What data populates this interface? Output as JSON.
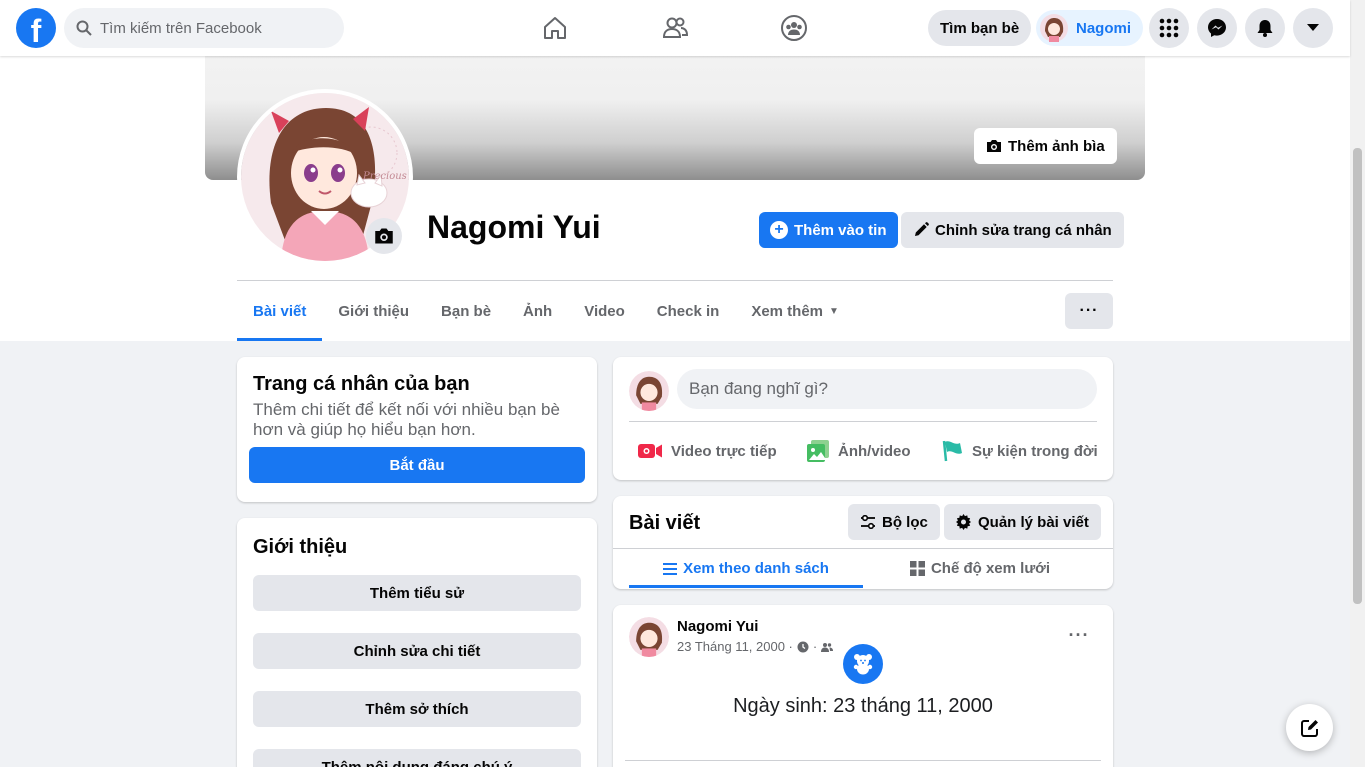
{
  "topbar": {
    "search_placeholder": "Tìm kiếm trên Facebook",
    "find_friends": "Tìm bạn bè",
    "profile_name": "Nagomi",
    "logo_letter": "f"
  },
  "cover": {
    "add_cover_label": "Thêm ảnh bìa"
  },
  "profile": {
    "name": "Nagomi Yui",
    "add_story_label": "Thêm vào tin",
    "edit_profile_label": "Chỉnh sửa trang cá nhân"
  },
  "tabs": [
    {
      "label": "Bài viết"
    },
    {
      "label": "Giới thiệu"
    },
    {
      "label": "Bạn bè"
    },
    {
      "label": "Ảnh"
    },
    {
      "label": "Video"
    },
    {
      "label": "Check in"
    },
    {
      "label": "Xem thêm"
    }
  ],
  "more_label": "···",
  "profile_card": {
    "title": "Trang cá nhân của bạn",
    "description": "Thêm chi tiết để kết nối với nhiều bạn bè hơn và giúp họ hiểu bạn hơn.",
    "start_label": "Bắt đầu"
  },
  "intro": {
    "title": "Giới thiệu",
    "buttons": [
      "Thêm tiểu sử",
      "Chỉnh sửa chi tiết",
      "Thêm sở thích",
      "Thêm nội dung đáng chú ý"
    ]
  },
  "composer": {
    "placeholder": "Bạn đang nghĩ gì?",
    "actions": [
      "Video trực tiếp",
      "Ảnh/video",
      "Sự kiện trong đời"
    ]
  },
  "posts": {
    "title": "Bài viết",
    "filter_label": "Bộ lọc",
    "manage_label": "Quản lý bài viết",
    "list_view_label": "Xem theo danh sách",
    "grid_view_label": "Chế độ xem lưới"
  },
  "post": {
    "author": "Nagomi Yui",
    "date": "23 Tháng 11, 2000 ·",
    "body": "Ngày sinh: 23 tháng 11, 2000",
    "menu": "···"
  },
  "colors": {
    "brand": "#1877f2",
    "background": "#f0f2f5"
  }
}
